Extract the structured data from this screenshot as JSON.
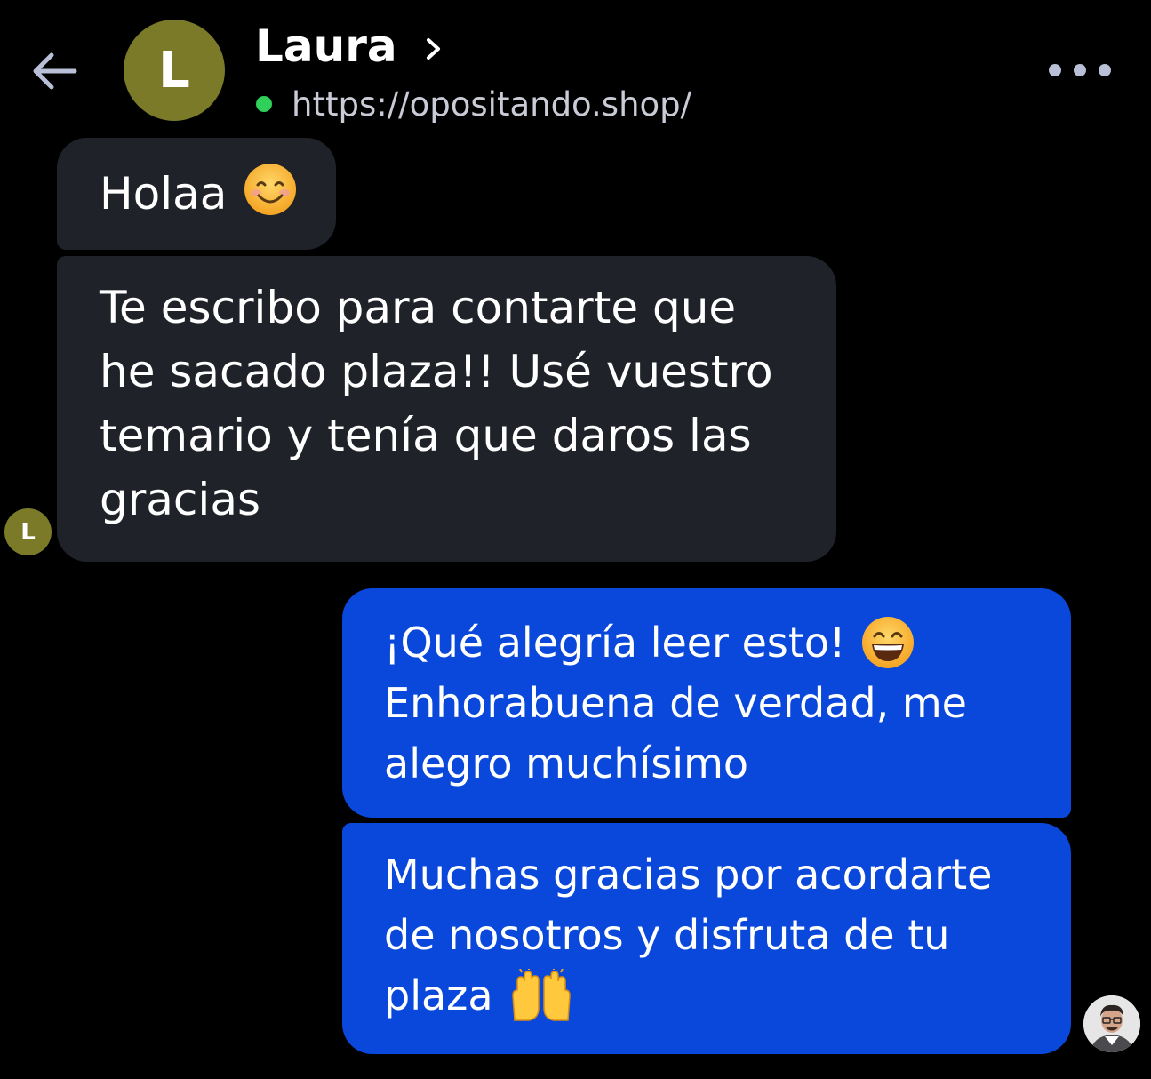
{
  "header": {
    "back_icon": "arrow-left-icon",
    "contact_initial": "L",
    "contact_name": "Laura",
    "chevron_icon": "chevron-right-icon",
    "status_color": "#2fd15a",
    "url": "https://opositando.shop/",
    "more_icon": "more-horizontal-icon"
  },
  "messages": {
    "incoming_color": "#1f2228",
    "outgoing_color": "#0a48dc",
    "m1": {
      "text": "Holaa",
      "emoji": "smiling-face-with-smiling-eyes"
    },
    "m2": {
      "lines": [
        "Te escribo para contarte que",
        "he sacado plaza!! Usé vuestro",
        "temario y tenía que daros las",
        "gracias"
      ]
    },
    "m3": {
      "lines": [
        "¡Qué alegría leer esto!",
        "Enhorabuena de verdad, me",
        "alegro muchísimo"
      ],
      "emoji": "grinning-face-with-smiling-eyes"
    },
    "m4": {
      "lines": [
        "Muchas gracias por acordarte",
        "de nosotros y disfruta de tu",
        "plaza"
      ],
      "emoji": "raising-hands"
    }
  },
  "avatars": {
    "contact_small_initial": "L",
    "contact_color": "#7b7a29",
    "me": "user-photo-avatar"
  }
}
